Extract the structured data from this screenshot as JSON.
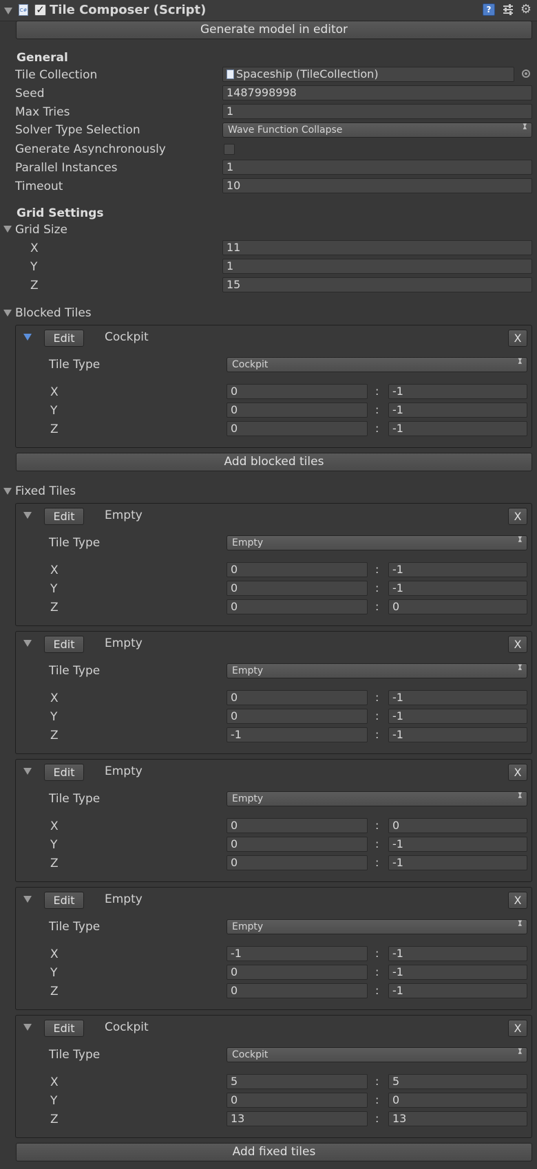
{
  "header": {
    "title": "Tile Composer (Script)",
    "script_icon_text": "C#",
    "icons": [
      "help-icon",
      "preset-icon",
      "gear-icon"
    ]
  },
  "generate_button": "Generate model in editor",
  "general": {
    "heading": "General",
    "tile_collection_label": "Tile Collection",
    "tile_collection_value": "Spaceship (TileCollection)",
    "seed_label": "Seed",
    "seed_value": "1487998998",
    "max_tries_label": "Max Tries",
    "max_tries_value": "1",
    "solver_label": "Solver Type Selection",
    "solver_value": "Wave Function Collapse",
    "async_label": "Generate Asynchronously",
    "async_checked": false,
    "parallel_label": "Parallel Instances",
    "parallel_value": "1",
    "timeout_label": "Timeout",
    "timeout_value": "10"
  },
  "grid": {
    "heading": "Grid Settings",
    "size_label": "Grid Size",
    "x_label": "X",
    "x_value": "11",
    "y_label": "Y",
    "y_value": "1",
    "z_label": "Z",
    "z_value": "15"
  },
  "blocked": {
    "heading": "Blocked Tiles",
    "add_button": "Add blocked tiles",
    "items": [
      {
        "edit": "Edit",
        "name": "Cockpit",
        "remove": "X",
        "type_label": "Tile Type",
        "type": "Cockpit",
        "x_label": "X",
        "x_min": "0",
        "x_max": "-1",
        "y_label": "Y",
        "y_min": "0",
        "y_max": "-1",
        "z_label": "Z",
        "z_min": "0",
        "z_max": "-1",
        "sep": ":"
      }
    ]
  },
  "fixed": {
    "heading": "Fixed Tiles",
    "add_button": "Add fixed tiles",
    "items": [
      {
        "edit": "Edit",
        "name": "Empty",
        "remove": "X",
        "type_label": "Tile Type",
        "type": "Empty",
        "x_label": "X",
        "x_min": "0",
        "x_max": "-1",
        "y_label": "Y",
        "y_min": "0",
        "y_max": "-1",
        "z_label": "Z",
        "z_min": "0",
        "z_max": "0",
        "sep": ":"
      },
      {
        "edit": "Edit",
        "name": "Empty",
        "remove": "X",
        "type_label": "Tile Type",
        "type": "Empty",
        "x_label": "X",
        "x_min": "0",
        "x_max": "-1",
        "y_label": "Y",
        "y_min": "0",
        "y_max": "-1",
        "z_label": "Z",
        "z_min": "-1",
        "z_max": "-1",
        "sep": ":"
      },
      {
        "edit": "Edit",
        "name": "Empty",
        "remove": "X",
        "type_label": "Tile Type",
        "type": "Empty",
        "x_label": "X",
        "x_min": "0",
        "x_max": "0",
        "y_label": "Y",
        "y_min": "0",
        "y_max": "-1",
        "z_label": "Z",
        "z_min": "0",
        "z_max": "-1",
        "sep": ":"
      },
      {
        "edit": "Edit",
        "name": "Empty",
        "remove": "X",
        "type_label": "Tile Type",
        "type": "Empty",
        "x_label": "X",
        "x_min": "-1",
        "x_max": "-1",
        "y_label": "Y",
        "y_min": "0",
        "y_max": "-1",
        "z_label": "Z",
        "z_min": "0",
        "z_max": "-1",
        "sep": ":"
      },
      {
        "edit": "Edit",
        "name": "Cockpit",
        "remove": "X",
        "type_label": "Tile Type",
        "type": "Cockpit",
        "x_label": "X",
        "x_min": "5",
        "x_max": "5",
        "y_label": "Y",
        "y_min": "0",
        "y_max": "0",
        "z_label": "Z",
        "z_min": "13",
        "z_max": "13",
        "sep": ":"
      }
    ]
  }
}
